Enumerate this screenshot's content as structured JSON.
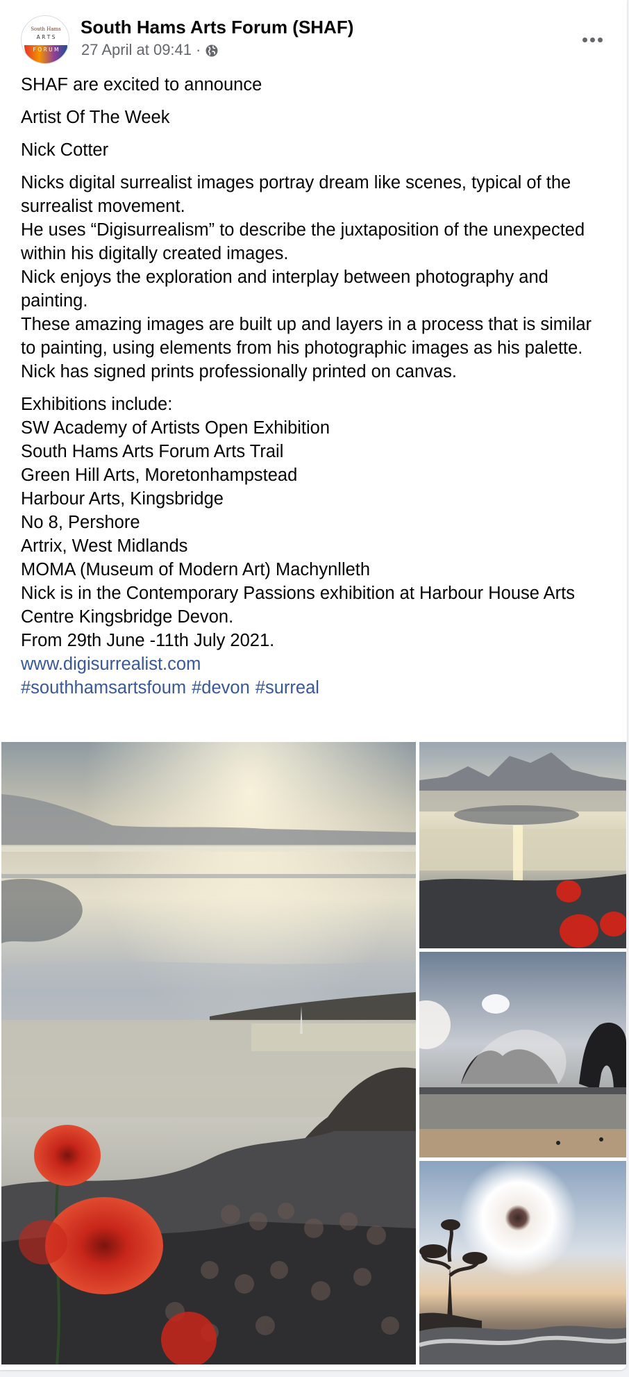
{
  "post": {
    "page_name": "South Hams Arts Forum (SHAF)",
    "timestamp": "27 April at 09:41",
    "separator": "·",
    "privacy_icon": "globe-icon",
    "more_icon": "more-options-icon",
    "avatar": {
      "logo_text_top": "South Hams",
      "logo_text_mid": "A R T S",
      "logo_text_bottom": "F O R U M"
    },
    "text": {
      "intro": "SHAF are excited to announce",
      "heading": "Artist Of The Week",
      "artist": "Nick Cotter",
      "description": [
        "Nicks digital surrealist images portray dream like scenes, typical of the surrealist movement.",
        "He uses “Digisurrealism” to describe the juxtaposition of the unexpected within his digitally created images.",
        "Nick enjoys the exploration and interplay between photography and painting.",
        "These amazing images are built up and layers in a process that is similar to painting, using elements from his photographic images as his palette.",
        "Nick has signed prints professionally printed on canvas."
      ],
      "exhibitions_title": "Exhibitions include:",
      "exhibitions": [
        "SW Academy of Artists Open Exhibition",
        "South Hams Arts Forum Arts Trail",
        "Green Hill Arts, Moretonhampstead",
        "Harbour Arts, Kingsbridge",
        "No 8, Pershore",
        "Artrix, West Midlands",
        "MOMA (Museum of Modern Art) Machynlleth"
      ],
      "current_show": "Nick is in the Contemporary Passions exhibition at  Harbour House Arts Centre Kingsbridge Devon.",
      "dates": "From 29th June -11th July 2021.",
      "website": "www.digisurrealist.com",
      "hashtags": [
        "#southhamsartsfoum",
        "#devon",
        "#surreal"
      ]
    },
    "photos": [
      "photo-sea-poppies-crowd",
      "photo-mountain-poppies",
      "photo-wave-arch",
      "photo-eye-sun-tree"
    ]
  },
  "colors": {
    "link": "#385898",
    "text": "#050505",
    "secondary": "#65676b",
    "poppy": "#c8261a"
  }
}
